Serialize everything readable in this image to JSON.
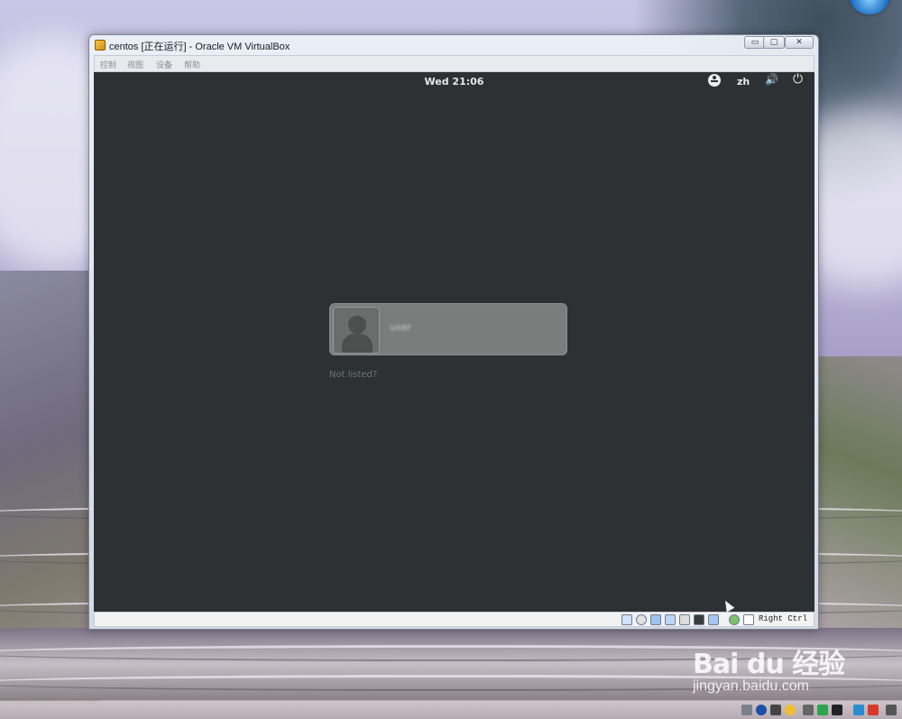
{
  "window": {
    "title": "centos [正在运行] - Oracle VM VirtualBox",
    "minimize_glyph": "▭",
    "maximize_glyph": "▢",
    "close_glyph": "✕"
  },
  "menubar": {
    "items": [
      {
        "label": "控制"
      },
      {
        "label": "视图"
      },
      {
        "label": "设备"
      },
      {
        "label": "帮助"
      }
    ]
  },
  "guest": {
    "clock": "Wed 21:06",
    "language": "zh",
    "volume_glyph": "🔊",
    "power_glyph": "⏻",
    "user_card": {
      "username": "user"
    },
    "not_listed": "Not listed?"
  },
  "statusbar": {
    "host_key": "Right Ctrl",
    "icons": [
      "hard-disk-icon",
      "optical-drive-icon",
      "usb-icon",
      "network-icon",
      "shared-folders-icon",
      "display-icon",
      "video-capture-icon",
      "guest-additions-icon",
      "mouse-integration-icon",
      "keyboard-capture-icon"
    ]
  },
  "watermark": {
    "logo": "Bai du 经验",
    "url": "jingyan.baidu.com"
  },
  "colors": {
    "guest_background": "#2d3134",
    "user_card": "#7b7c7c",
    "window_chrome": "#dce3ee"
  }
}
